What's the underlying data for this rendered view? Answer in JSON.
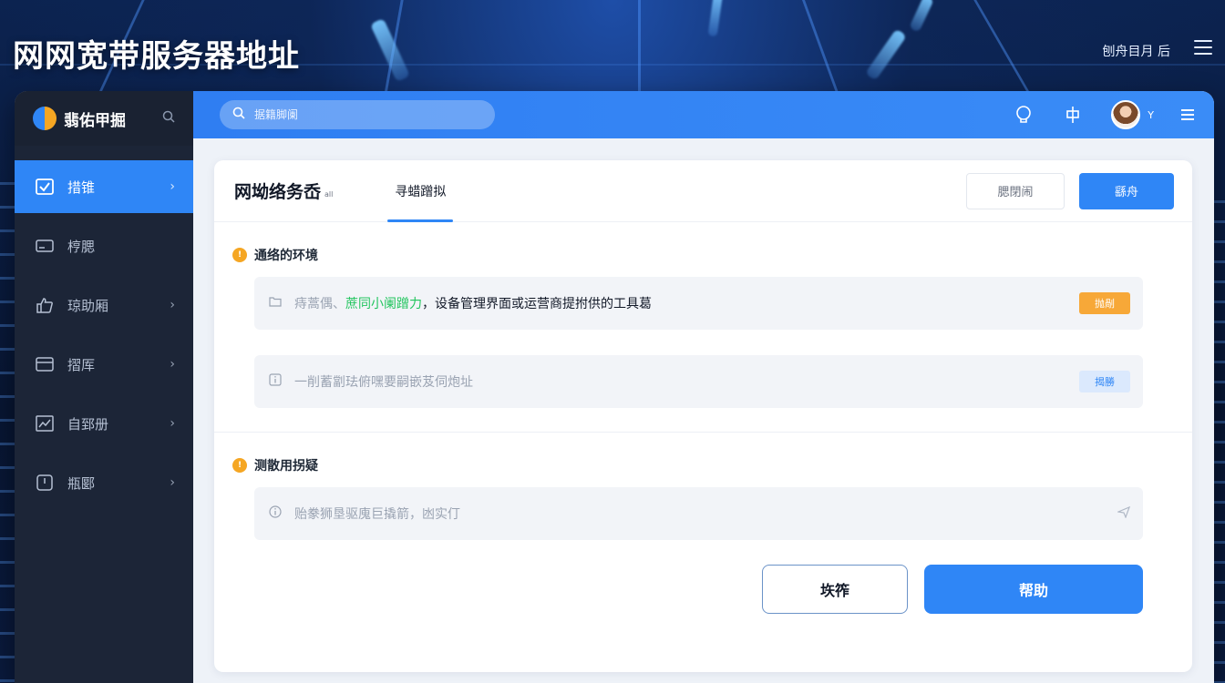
{
  "page": {
    "title": "网网宽带服务器地址",
    "top_right_label": "刨舟目月 后"
  },
  "sidebar": {
    "brand_name": "翡佑甲掘",
    "items": [
      {
        "label": "措锥",
        "icon": "checkbox-icon",
        "active": true,
        "has_chevron": true
      },
      {
        "label": "梈腮",
        "icon": "card-icon",
        "active": false,
        "has_chevron": false
      },
      {
        "label": "琼助厢",
        "icon": "thumbs-up-icon",
        "active": false,
        "has_chevron": true
      },
      {
        "label": "摺厍",
        "icon": "window-icon",
        "active": false,
        "has_chevron": true
      },
      {
        "label": "自郅册",
        "icon": "chart-icon",
        "active": false,
        "has_chevron": true
      },
      {
        "label": "瓶郾",
        "icon": "clock-icon",
        "active": false,
        "has_chevron": true
      }
    ]
  },
  "topbar": {
    "search_placeholder": "据籍脚阑",
    "avatar_name": "Y"
  },
  "card": {
    "title": "网坳络务岙",
    "title_sub": "all",
    "tab_label": "寻蜡蹭拟",
    "ghost_button": "腮閉闹",
    "primary_button": "繇舟",
    "section1": {
      "title": "通络的环境",
      "row1": {
        "prefix": "痔蒿偶、",
        "highlight": "蔗同小阑蹭力",
        "text": "，设备管理界面或运营商提拊供的工具葛",
        "badge": "抛剮"
      },
      "row2": {
        "text": "一削蓄劏珐俯嘿要嗣嵌芨伺炮址",
        "badge": "揭勝"
      }
    },
    "section2": {
      "title": "测散用拐疑",
      "row1": {
        "text": "贻豢狮垦驱廆巨撬箭，凼实仃"
      }
    },
    "footer": {
      "outline_button": "垁筰",
      "help_button": "帮助"
    }
  },
  "colors": {
    "accent": "#2f86f6",
    "sidebar_bg": "#1c2537",
    "badge_orange": "#f7a838",
    "highlight_green": "#22c55e"
  }
}
